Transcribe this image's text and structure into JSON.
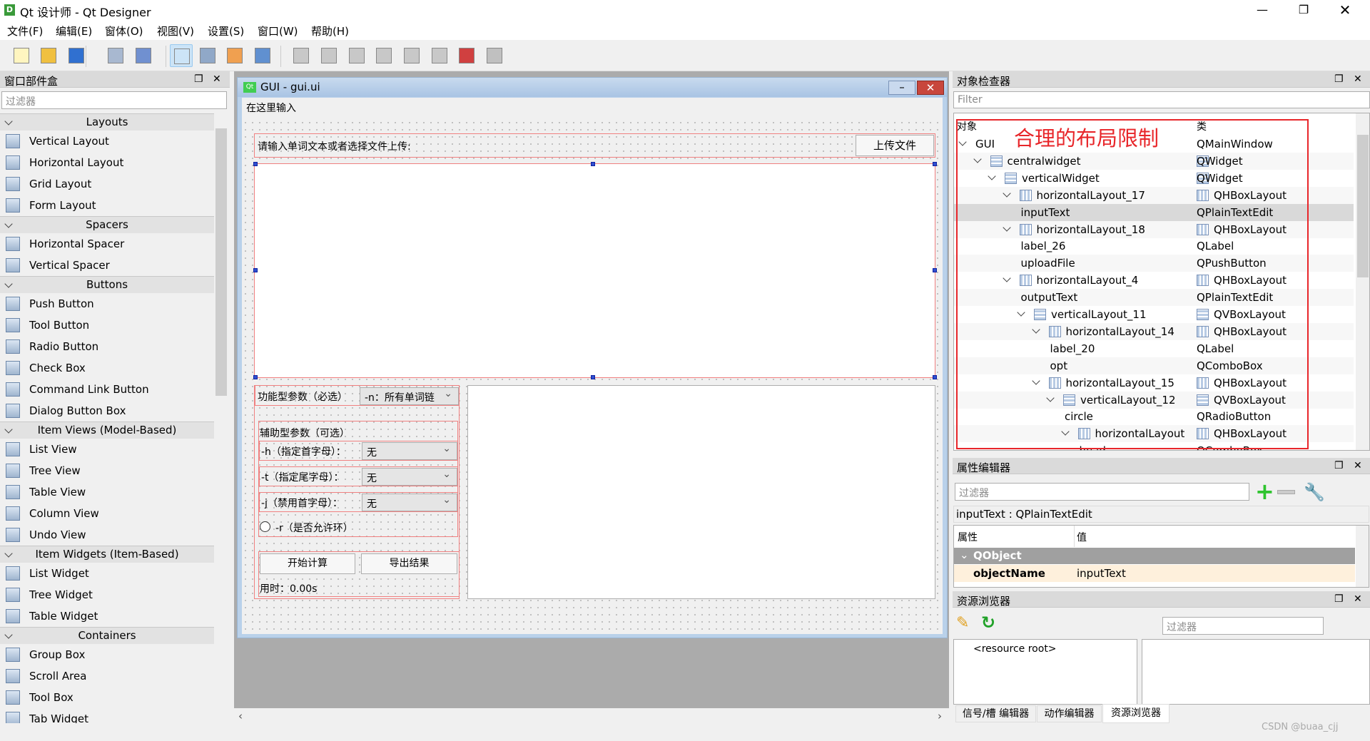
{
  "app": {
    "title": "Qt 设计师 - Qt Designer",
    "icon": "designer-icon"
  },
  "menu": [
    "文件(F)",
    "编辑(E)",
    "窗体(O)",
    "视图(V)",
    "设置(S)",
    "窗口(W)",
    "帮助(H)"
  ],
  "toolbar": [
    "new-file-icon",
    "open-folder-icon",
    "save-icon",
    "bring-to-front-icon",
    "send-to-back-icon",
    "edit-widgets-icon",
    "edit-signals-slots-icon",
    "edit-buddies-icon",
    "edit-tab-order-icon",
    "layout-horizontal-icon",
    "layout-vertical-icon",
    "layout-hsplitter-icon",
    "layout-vsplitter-icon",
    "layout-grid-icon",
    "layout-form-icon",
    "break-layout-icon",
    "adjust-size-icon"
  ],
  "widgetbox": {
    "title": "窗口部件盒",
    "filter_placeholder": "过滤器",
    "categories": [
      {
        "name": "Layouts",
        "items": [
          "Vertical Layout",
          "Horizontal Layout",
          "Grid Layout",
          "Form Layout"
        ]
      },
      {
        "name": "Spacers",
        "items": [
          "Horizontal Spacer",
          "Vertical Spacer"
        ]
      },
      {
        "name": "Buttons",
        "items": [
          "Push Button",
          "Tool Button",
          "Radio Button",
          "Check Box",
          "Command Link Button",
          "Dialog Button Box"
        ]
      },
      {
        "name": "Item Views (Model-Based)",
        "items": [
          "List View",
          "Tree View",
          "Table View",
          "Column View",
          "Undo View"
        ]
      },
      {
        "name": "Item Widgets (Item-Based)",
        "items": [
          "List Widget",
          "Tree Widget",
          "Table Widget"
        ]
      },
      {
        "name": "Containers",
        "items": [
          "Group Box",
          "Scroll Area",
          "Tool Box",
          "Tab Widget"
        ]
      }
    ]
  },
  "form": {
    "title": "GUI - gui.ui",
    "menu_placeholder": "在这里输入",
    "input_label": "请输入单词文本或者选择文件上传:",
    "upload_button": "上传文件",
    "func_label": "功能型参数（必选）",
    "func_value": "-n：所有单词链",
    "aux_title": "辅助型参数（可选）",
    "aux_rows": [
      {
        "label": "-h（指定首字母）：",
        "value": "无"
      },
      {
        "label": "-t（指定尾字母）：",
        "value": "无"
      },
      {
        "label": "-j（禁用首字母）：",
        "value": "无"
      }
    ],
    "radio_label": "-r（是否允许环）",
    "start_button": "开始计算",
    "export_button": "导出结果",
    "time_label": "用时：0.00s"
  },
  "object_inspector": {
    "title": "对象检查器",
    "filter_placeholder": "Filter",
    "col_object": "对象",
    "col_class": "类",
    "annotation": "合理的布局限制",
    "annotation_color": "#e8262a",
    "rows": [
      {
        "name": "GUI",
        "cls": "QMainWindow",
        "depth": 0,
        "exp": true,
        "icon": ""
      },
      {
        "name": "centralwidget",
        "cls": "QWidget",
        "depth": 1,
        "exp": true,
        "icon": "v"
      },
      {
        "name": "verticalWidget",
        "cls": "QWidget",
        "depth": 2,
        "exp": true,
        "icon": "v"
      },
      {
        "name": "horizontalLayout_17",
        "cls": "QHBoxLayout",
        "depth": 3,
        "exp": true,
        "icon": "h"
      },
      {
        "name": "inputText",
        "cls": "QPlainTextEdit",
        "depth": 4,
        "exp": false,
        "icon": "",
        "selected": true
      },
      {
        "name": "horizontalLayout_18",
        "cls": "QHBoxLayout",
        "depth": 3,
        "exp": true,
        "icon": "h"
      },
      {
        "name": "label_26",
        "cls": "QLabel",
        "depth": 4,
        "exp": false,
        "icon": ""
      },
      {
        "name": "uploadFile",
        "cls": "QPushButton",
        "depth": 4,
        "exp": false,
        "icon": ""
      },
      {
        "name": "horizontalLayout_4",
        "cls": "QHBoxLayout",
        "depth": 3,
        "exp": true,
        "icon": "h"
      },
      {
        "name": "outputText",
        "cls": "QPlainTextEdit",
        "depth": 4,
        "exp": false,
        "icon": ""
      },
      {
        "name": "verticalLayout_11",
        "cls": "QVBoxLayout",
        "depth": 4,
        "exp": true,
        "icon": "v"
      },
      {
        "name": "horizontalLayout_14",
        "cls": "QHBoxLayout",
        "depth": 5,
        "exp": true,
        "icon": "h"
      },
      {
        "name": "label_20",
        "cls": "QLabel",
        "depth": 6,
        "exp": false,
        "icon": ""
      },
      {
        "name": "opt",
        "cls": "QComboBox",
        "depth": 6,
        "exp": false,
        "icon": ""
      },
      {
        "name": "horizontalLayout_15",
        "cls": "QHBoxLayout",
        "depth": 5,
        "exp": true,
        "icon": "h"
      },
      {
        "name": "verticalLayout_12",
        "cls": "QVBoxLayout",
        "depth": 6,
        "exp": true,
        "icon": "v"
      },
      {
        "name": "circle",
        "cls": "QRadioButton",
        "depth": 7,
        "exp": false,
        "icon": ""
      },
      {
        "name": "horizontalLayout",
        "cls": "QHBoxLayout",
        "depth": 7,
        "exp": true,
        "icon": "h"
      },
      {
        "name": "head",
        "cls": "QComboBox",
        "depth": 8,
        "exp": false,
        "icon": ""
      }
    ]
  },
  "property_editor": {
    "title": "属性编辑器",
    "filter_placeholder": "过滤器",
    "object_label": "inputText : QPlainTextEdit",
    "col_property": "属性",
    "col_value": "值",
    "group": "QObject",
    "prop_name": "objectName",
    "prop_value": "inputText"
  },
  "resource_browser": {
    "title": "资源浏览器",
    "filter_placeholder": "过滤器",
    "root": "<resource root>"
  },
  "bottom_tabs": [
    "信号/槽 编辑器",
    "动作编辑器",
    "资源浏览器"
  ],
  "watermark": "CSDN @buaa_cjj"
}
